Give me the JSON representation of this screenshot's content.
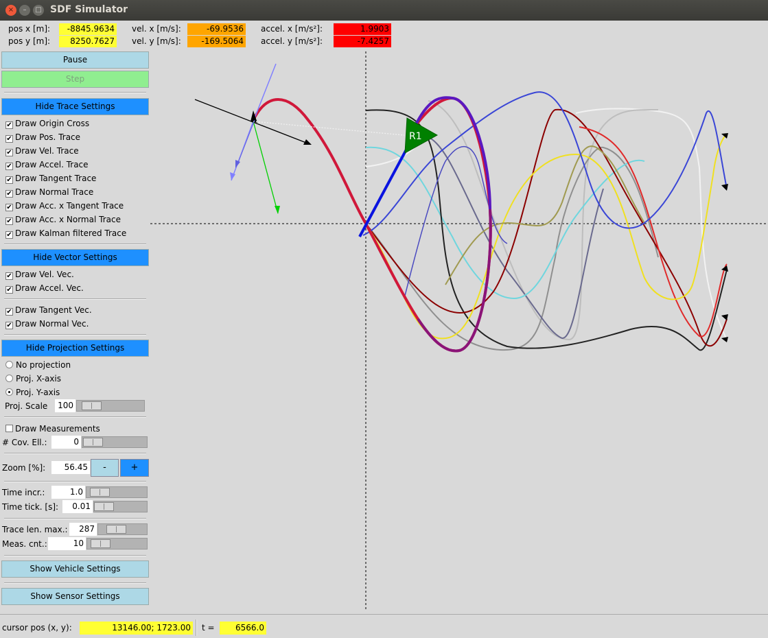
{
  "window": {
    "title": "SDF Simulator",
    "close_glyph": "×",
    "min_glyph": "–",
    "max_glyph": "□"
  },
  "readouts": {
    "pos_x_label": "pos x [m]:",
    "pos_x": "-8845.9634",
    "pos_y_label": "pos y [m]:",
    "pos_y": "8250.7627",
    "vel_x_label": "vel. x [m/s]:",
    "vel_x": "-69.9536",
    "vel_y_label": "vel. y [m/s]:",
    "vel_y": "-169.5064",
    "acc_x_label": "accel. x [m/s²]:",
    "acc_x": "1.9903",
    "acc_y_label": "accel. y [m/s²]:",
    "acc_y": "-7.4257"
  },
  "sidebar": {
    "pause_label": "Pause",
    "step_label": "Step",
    "trace_settings_label": "Hide Trace Settings",
    "trace_options": [
      "Draw Origin Cross",
      "Draw Pos. Trace",
      "Draw Vel. Trace",
      "Draw Accel. Trace",
      "Draw Tangent Trace",
      "Draw Normal Trace",
      "Draw Acc. x Tangent Trace",
      "Draw Acc. x Normal Trace",
      "Draw Kalman filtered Trace"
    ],
    "vector_settings_label": "Hide Vector Settings",
    "vector_options": [
      "Draw Vel. Vec.",
      "Draw Accel. Vec.",
      "Draw Tangent Vec.",
      "Draw Normal Vec."
    ],
    "projection_settings_label": "Hide Projection Settings",
    "projection_options": [
      "No projection",
      "Proj. X-axis",
      "Proj. Y-axis"
    ],
    "projection_selected": "Proj. Y-axis",
    "proj_scale_label": "Proj. Scale",
    "proj_scale_value": "100",
    "draw_measurements_label": "Draw Measurements",
    "cov_ell_label": "# Cov. Ell.:",
    "cov_ell_value": "0",
    "zoom_label": "Zoom [%]:",
    "zoom_value": "56.45",
    "zoom_minus": "-",
    "zoom_plus": "+",
    "time_incr_label": "Time incr.:",
    "time_incr_value": "1.0",
    "time_tick_label": "Time tick. [s]:",
    "time_tick_value": "0.01",
    "trace_len_label": "Trace len. max.:",
    "trace_len_value": "287",
    "meas_cnt_label": "Meas. cnt.:",
    "meas_cnt_value": "10",
    "vehicle_settings_label": "Show Vehicle Settings",
    "sensor_settings_label": "Show Sensor Settings"
  },
  "canvas": {
    "vehicle_label": "R1",
    "vehicle_color": "#008000"
  },
  "status": {
    "cursor_label": "cursor pos (x, y):",
    "cursor_value": "13146.00; 1723.00",
    "t_label": "t =",
    "t_value": "6566.0"
  },
  "colors": {
    "readout_pos": "#ffff33",
    "readout_vel": "#ffa500",
    "readout_acc": "#ff0000",
    "button_blue": "#1e90ff",
    "button_light": "#add8e6"
  }
}
